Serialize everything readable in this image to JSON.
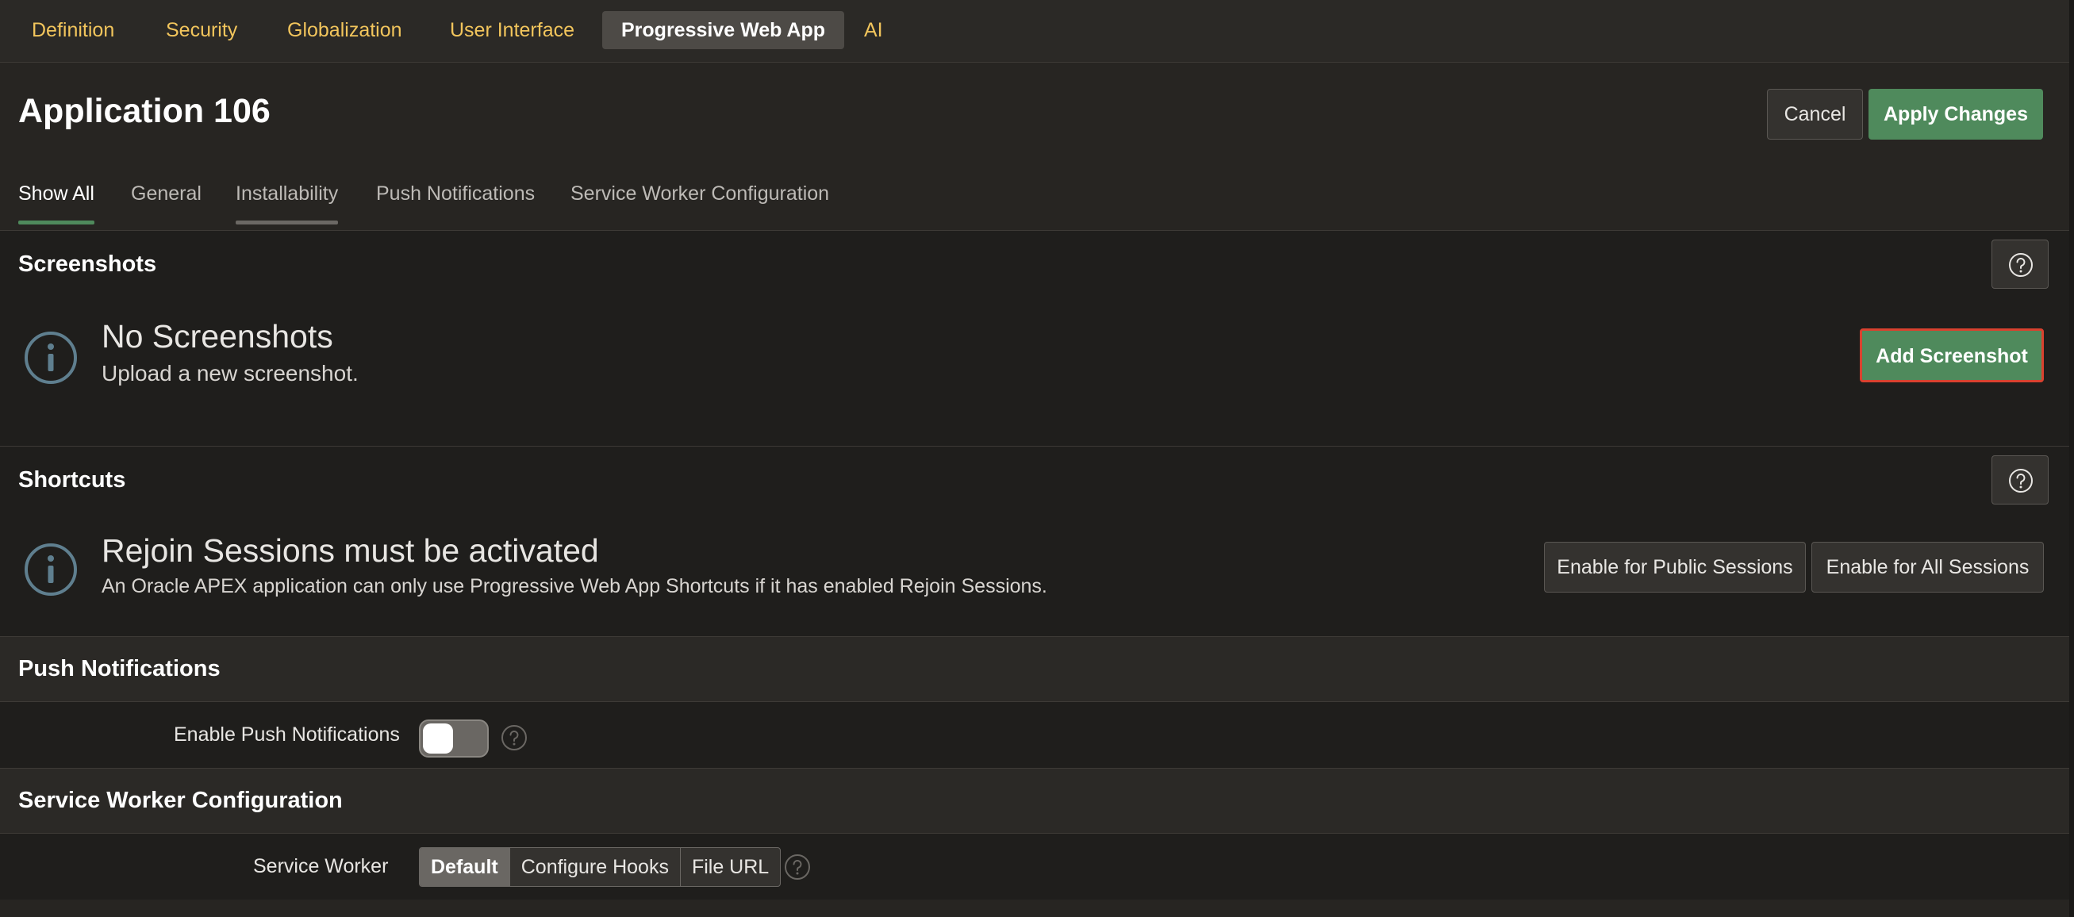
{
  "top_tabs": [
    {
      "label": "Definition"
    },
    {
      "label": "Security"
    },
    {
      "label": "Globalization"
    },
    {
      "label": "User Interface"
    },
    {
      "label": "Progressive Web App"
    },
    {
      "label": "AI"
    }
  ],
  "header": {
    "title": "Application 106",
    "cancel_label": "Cancel",
    "apply_label": "Apply Changes"
  },
  "sub_tabs": [
    {
      "label": "Show All"
    },
    {
      "label": "General"
    },
    {
      "label": "Installability"
    },
    {
      "label": "Push Notifications"
    },
    {
      "label": "Service Worker Configuration"
    }
  ],
  "screenshots": {
    "title": "Screenshots",
    "empty_title": "No Screenshots",
    "empty_sub": "Upload a new screenshot.",
    "add_label": "Add Screenshot"
  },
  "shortcuts": {
    "title": "Shortcuts",
    "notice_title": "Rejoin Sessions must be activated",
    "notice_sub": "An Oracle APEX application can only use Progressive Web App Shortcuts if it has enabled Rejoin Sessions.",
    "public_label": "Enable for Public Sessions",
    "all_label": "Enable for All Sessions"
  },
  "push": {
    "title": "Push Notifications",
    "field_label": "Enable Push Notifications",
    "enabled": false
  },
  "service_worker": {
    "title": "Service Worker Configuration",
    "field_label": "Service Worker",
    "options": [
      "Default",
      "Configure Hooks",
      "File URL"
    ],
    "selected": "Default"
  },
  "colors": {
    "accent": "#4f8a5c",
    "link": "#f2c55c",
    "highlight_border": "#d9412f"
  }
}
